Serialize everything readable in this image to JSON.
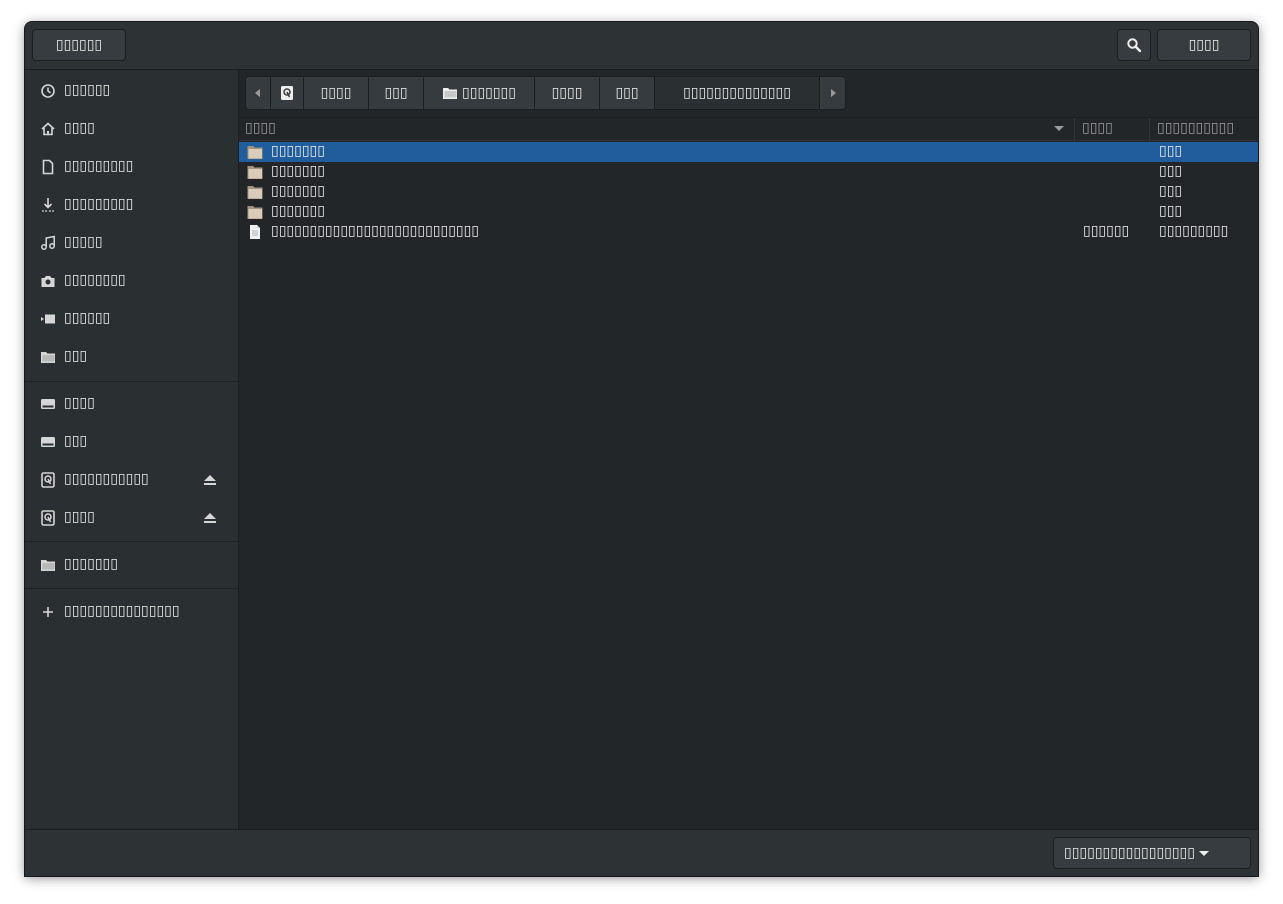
{
  "header": {
    "left_button": "▯▯▯▯▯▯",
    "right_button": "▯▯▯▯"
  },
  "sidebar": {
    "items": [
      {
        "label": "▯▯▯▯▯▯",
        "icon": "clock-icon"
      },
      {
        "label": "▯▯▯▯",
        "icon": "home-icon"
      },
      {
        "label": "▯▯▯▯▯▯▯▯▯",
        "icon": "document-icon"
      },
      {
        "label": "▯▯▯▯▯▯▯▯▯",
        "icon": "download-icon"
      },
      {
        "label": "▯▯▯▯▯",
        "icon": "music-icon"
      },
      {
        "label": "▯▯▯▯▯▯▯▯",
        "icon": "camera-icon"
      },
      {
        "label": "▯▯▯▯▯▯",
        "icon": "video-icon"
      },
      {
        "label": "▯▯▯",
        "icon": "folder-icon"
      }
    ],
    "devices": [
      {
        "label": "▯▯▯▯",
        "icon": "drive-icon"
      },
      {
        "label": "▯▯▯",
        "icon": "drive-icon"
      },
      {
        "label": "▯▯▯▯▯▯▯▯▯▯▯",
        "icon": "harddisk-icon",
        "eject": true
      },
      {
        "label": "▯▯▯▯",
        "icon": "harddisk-icon",
        "eject": true
      }
    ],
    "bookmarks": [
      {
        "label": "▯▯▯▯▯▯▯",
        "icon": "folder-icon"
      }
    ],
    "other_locations": "▯▯▯▯▯▯▯▯▯▯▯▯▯▯▯"
  },
  "pathbar": {
    "crumbs": [
      "▯▯▯▯",
      "▯▯▯",
      "▯▯▯▯▯▯▯",
      "▯▯▯▯",
      "▯▯▯",
      "▯▯▯▯▯▯▯▯▯▯▯▯▯▯"
    ]
  },
  "columns": {
    "name": "▯▯▯▯",
    "size": "▯▯▯▯",
    "modified": "▯▯▯▯▯▯▯▯▯▯"
  },
  "files": [
    {
      "name": "▯▯▯▯▯▯▯",
      "size": "",
      "modified": "▯▯▯",
      "type": "folder",
      "selected": true
    },
    {
      "name": "▯▯▯▯▯▯▯",
      "size": "",
      "modified": "▯▯▯",
      "type": "folder"
    },
    {
      "name": "▯▯▯▯▯▯▯",
      "size": "",
      "modified": "▯▯▯",
      "type": "folder"
    },
    {
      "name": "▯▯▯▯▯▯▯",
      "size": "",
      "modified": "▯▯▯",
      "type": "folder"
    },
    {
      "name": "▯▯▯▯▯▯▯▯▯▯▯▯▯▯▯▯▯▯▯▯▯▯▯▯▯▯▯",
      "size": "▯▯▯▯▯▯",
      "modified": "▯▯▯▯▯▯▯▯▯",
      "type": "file"
    }
  ],
  "footer": {
    "filter_label": "▯▯▯▯▯▯▯▯▯▯▯▯▯▯▯▯▯"
  },
  "colors": {
    "selection": "#215d9c",
    "background": "#222629",
    "sidebar": "#2a2f31"
  }
}
